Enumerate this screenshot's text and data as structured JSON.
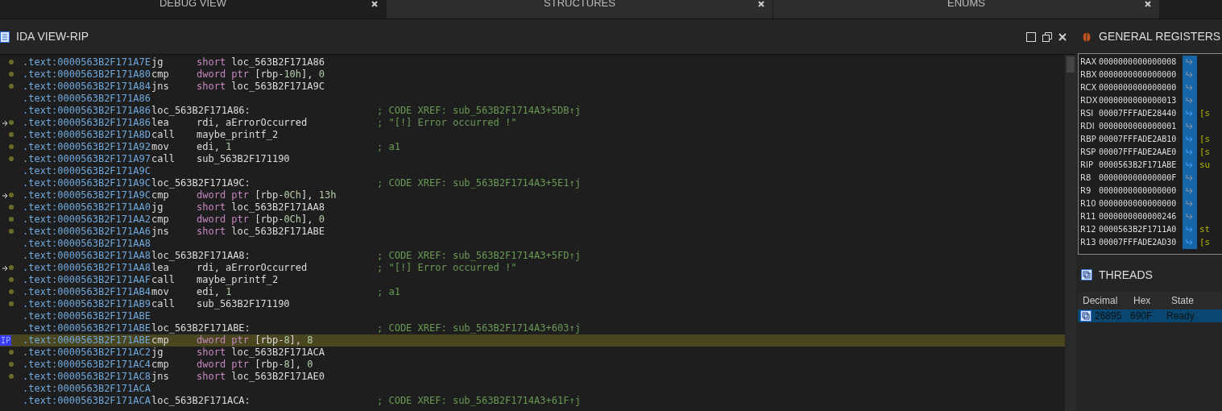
{
  "tabs": [
    {
      "label": "DEBUG VIEW",
      "selected": true
    },
    {
      "label": "STRUCTURES",
      "selected": false
    },
    {
      "label": "ENUMS",
      "selected": false
    }
  ],
  "ida_view": {
    "title": "IDA VIEW-RIP",
    "lines": [
      {
        "kind": "instr",
        "addr": ".text:0000563B2F171A7E",
        "mn": "jg",
        "ops": [
          {
            "kind": "kw",
            "t": "short "
          },
          {
            "kind": "name",
            "t": "loc_563B2F171A86"
          }
        ],
        "current": false,
        "arrow": false
      },
      {
        "kind": "instr",
        "addr": ".text:0000563B2F171A80",
        "mn": "cmp",
        "ops": [
          {
            "kind": "kw",
            "t": "dword ptr "
          },
          {
            "kind": "name",
            "t": "[rbp-"
          },
          {
            "kind": "num",
            "t": "10h"
          },
          {
            "kind": "name",
            "t": "], "
          },
          {
            "kind": "num",
            "t": "0"
          }
        ],
        "current": false,
        "arrow": false
      },
      {
        "kind": "instr",
        "addr": ".text:0000563B2F171A84",
        "mn": "jns",
        "ops": [
          {
            "kind": "kw",
            "t": "short "
          },
          {
            "kind": "name",
            "t": "loc_563B2F171A9C"
          }
        ],
        "current": false,
        "arrow": false
      },
      {
        "kind": "blank",
        "addr": ".text:0000563B2F171A86",
        "current": false
      },
      {
        "kind": "label",
        "addr": ".text:0000563B2F171A86",
        "label": "loc_563B2F171A86:",
        "comment": "; CODE XREF: sub_563B2F1714A3+5DB↑j",
        "current": false
      },
      {
        "kind": "instr",
        "addr": ".text:0000563B2F171A86",
        "mn": "lea",
        "ops": [
          {
            "kind": "name",
            "t": "rdi, aErrorOccurred"
          }
        ],
        "comment": "; \"[!] Error occurred !\"",
        "arrow": true,
        "current": false
      },
      {
        "kind": "instr",
        "addr": ".text:0000563B2F171A8D",
        "mn": "call",
        "ops": [
          {
            "kind": "name",
            "t": "maybe_printf_2"
          }
        ],
        "current": false,
        "arrow": false
      },
      {
        "kind": "instr",
        "addr": ".text:0000563B2F171A92",
        "mn": "mov",
        "ops": [
          {
            "kind": "name",
            "t": "edi, "
          },
          {
            "kind": "num",
            "t": "1"
          }
        ],
        "comment": "; a1",
        "current": false,
        "arrow": false
      },
      {
        "kind": "instr",
        "addr": ".text:0000563B2F171A97",
        "mn": "call",
        "ops": [
          {
            "kind": "name",
            "t": "sub_563B2F171190"
          }
        ],
        "current": false,
        "arrow": false
      },
      {
        "kind": "blank",
        "addr": ".text:0000563B2F171A9C",
        "current": false
      },
      {
        "kind": "label",
        "addr": ".text:0000563B2F171A9C",
        "label": "loc_563B2F171A9C:",
        "comment": "; CODE XREF: sub_563B2F1714A3+5E1↑j",
        "current": false
      },
      {
        "kind": "instr",
        "addr": ".text:0000563B2F171A9C",
        "mn": "cmp",
        "ops": [
          {
            "kind": "kw",
            "t": "dword ptr "
          },
          {
            "kind": "name",
            "t": "[rbp-"
          },
          {
            "kind": "num",
            "t": "0Ch"
          },
          {
            "kind": "name",
            "t": "], "
          },
          {
            "kind": "num",
            "t": "13h"
          }
        ],
        "arrow": true,
        "current": false
      },
      {
        "kind": "instr",
        "addr": ".text:0000563B2F171AA0",
        "mn": "jg",
        "ops": [
          {
            "kind": "kw",
            "t": "short "
          },
          {
            "kind": "name",
            "t": "loc_563B2F171AA8"
          }
        ],
        "current": false,
        "arrow": false
      },
      {
        "kind": "instr",
        "addr": ".text:0000563B2F171AA2",
        "mn": "cmp",
        "ops": [
          {
            "kind": "kw",
            "t": "dword ptr "
          },
          {
            "kind": "name",
            "t": "[rbp-"
          },
          {
            "kind": "num",
            "t": "0Ch"
          },
          {
            "kind": "name",
            "t": "], "
          },
          {
            "kind": "num",
            "t": "0"
          }
        ],
        "current": false,
        "arrow": false
      },
      {
        "kind": "instr",
        "addr": ".text:0000563B2F171AA6",
        "mn": "jns",
        "ops": [
          {
            "kind": "kw",
            "t": "short "
          },
          {
            "kind": "name",
            "t": "loc_563B2F171ABE"
          }
        ],
        "current": false,
        "arrow": false
      },
      {
        "kind": "blank",
        "addr": ".text:0000563B2F171AA8",
        "current": false
      },
      {
        "kind": "label",
        "addr": ".text:0000563B2F171AA8",
        "label": "loc_563B2F171AA8:",
        "comment": "; CODE XREF: sub_563B2F1714A3+5FD↑j",
        "current": false
      },
      {
        "kind": "instr",
        "addr": ".text:0000563B2F171AA8",
        "mn": "lea",
        "ops": [
          {
            "kind": "name",
            "t": "rdi, aErrorOccurred"
          }
        ],
        "comment": "; \"[!] Error occurred !\"",
        "arrow": true,
        "current": false
      },
      {
        "kind": "instr",
        "addr": ".text:0000563B2F171AAF",
        "mn": "call",
        "ops": [
          {
            "kind": "name",
            "t": "maybe_printf_2"
          }
        ],
        "current": false,
        "arrow": false
      },
      {
        "kind": "instr",
        "addr": ".text:0000563B2F171AB4",
        "mn": "mov",
        "ops": [
          {
            "kind": "name",
            "t": "edi, "
          },
          {
            "kind": "num",
            "t": "1"
          }
        ],
        "comment": "; a1",
        "current": false,
        "arrow": false
      },
      {
        "kind": "instr",
        "addr": ".text:0000563B2F171AB9",
        "mn": "call",
        "ops": [
          {
            "kind": "name",
            "t": "sub_563B2F171190"
          }
        ],
        "current": false,
        "arrow": false
      },
      {
        "kind": "blank",
        "addr": ".text:0000563B2F171ABE",
        "current": false
      },
      {
        "kind": "label",
        "addr": ".text:0000563B2F171ABE",
        "label": "loc_563B2F171ABE:",
        "comment": "; CODE XREF: sub_563B2F1714A3+603↑j",
        "current": false
      },
      {
        "kind": "instr",
        "addr": ".text:0000563B2F171ABE",
        "mn": "cmp",
        "ops": [
          {
            "kind": "kw",
            "t": "dword ptr "
          },
          {
            "kind": "name",
            "t": "[rbp-"
          },
          {
            "kind": "num",
            "t": "8"
          },
          {
            "kind": "name",
            "t": "], "
          },
          {
            "kind": "num",
            "t": "8"
          }
        ],
        "current": true,
        "arrow": false,
        "marker": "IP"
      },
      {
        "kind": "instr",
        "addr": ".text:0000563B2F171AC2",
        "mn": "jg",
        "ops": [
          {
            "kind": "kw",
            "t": "short "
          },
          {
            "kind": "name",
            "t": "loc_563B2F171ACA"
          }
        ],
        "current": false,
        "arrow": false
      },
      {
        "kind": "instr",
        "addr": ".text:0000563B2F171AC4",
        "mn": "cmp",
        "ops": [
          {
            "kind": "kw",
            "t": "dword ptr "
          },
          {
            "kind": "name",
            "t": "[rbp-"
          },
          {
            "kind": "num",
            "t": "8"
          },
          {
            "kind": "name",
            "t": "], "
          },
          {
            "kind": "num",
            "t": "0"
          }
        ],
        "current": false,
        "arrow": false
      },
      {
        "kind": "instr",
        "addr": ".text:0000563B2F171AC8",
        "mn": "jns",
        "ops": [
          {
            "kind": "kw",
            "t": "short "
          },
          {
            "kind": "name",
            "t": "loc_563B2F171AE0"
          }
        ],
        "current": false,
        "arrow": false
      },
      {
        "kind": "blank",
        "addr": ".text:0000563B2F171ACA",
        "current": false
      },
      {
        "kind": "label",
        "addr": ".text:0000563B2F171ACA",
        "label": "loc_563B2F171ACA:",
        "comment": "; CODE XREF: sub_563B2F1714A3+61F↑j",
        "current": false
      }
    ]
  },
  "registers": {
    "title": "GENERAL REGISTERS",
    "rows": [
      {
        "name": "RAX",
        "value": "0000000000000008",
        "pointer": false
      },
      {
        "name": "RBX",
        "value": "0000000000000000",
        "pointer": false
      },
      {
        "name": "RCX",
        "value": "0000000000000000",
        "pointer": false
      },
      {
        "name": "RDX",
        "value": "0000000000000013",
        "pointer": false
      },
      {
        "name": "RSI",
        "value": "00007FFFADE28440",
        "pointer": true,
        "info": "[s"
      },
      {
        "name": "RDI",
        "value": "0000000000000001",
        "pointer": false
      },
      {
        "name": "RBP",
        "value": "00007FFFADE2AB10",
        "pointer": true,
        "info": "[s"
      },
      {
        "name": "RSP",
        "value": "00007FFFADE2AAE0",
        "pointer": true,
        "info": "[s"
      },
      {
        "name": "RIP",
        "value": "0000563B2F171ABE",
        "pointer": true,
        "info": "su"
      },
      {
        "name": "R8",
        "value": "000000000000000F",
        "pointer": false
      },
      {
        "name": "R9",
        "value": "0000000000000000",
        "pointer": false
      },
      {
        "name": "R10",
        "value": "0000000000000000",
        "pointer": false
      },
      {
        "name": "R11",
        "value": "0000000000000246",
        "pointer": false
      },
      {
        "name": "R12",
        "value": "0000563B2F1711A0",
        "pointer": true,
        "info": "st"
      },
      {
        "name": "R13",
        "value": "00007FFFADE2AD30",
        "pointer": true,
        "info": "[s"
      }
    ]
  },
  "threads": {
    "title": "THREADS",
    "columns": [
      "Decimal",
      "Hex",
      "State"
    ],
    "rows": [
      {
        "decimal": "26895",
        "hex": "690F",
        "state": "Ready",
        "selected": true
      }
    ]
  }
}
